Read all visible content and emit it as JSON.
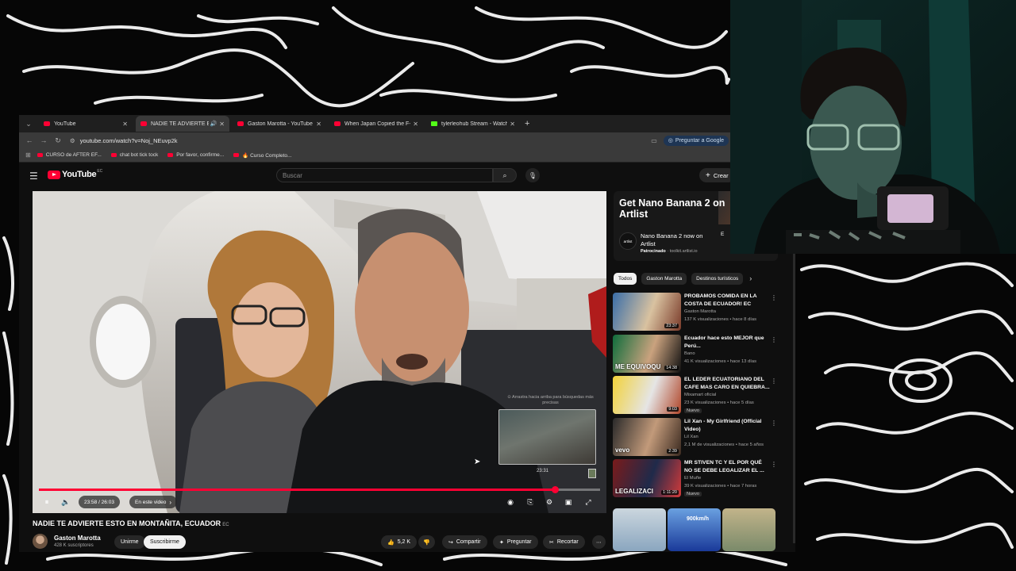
{
  "browser": {
    "tabs": [
      {
        "title": "YouTube",
        "active": false
      },
      {
        "title": "NADIE TE ADVIERTE ESTO E",
        "active": true
      },
      {
        "title": "Gaston Marotta - YouTube",
        "active": false
      },
      {
        "title": "When Japan Copied the F-16 -",
        "active": false
      },
      {
        "title": "tylerleohub Stream - Watch Li",
        "active": false
      }
    ],
    "url": "youtube.com/watch?v=Noj_NEuvp2k",
    "ask_google": "Preguntar a Google",
    "bookmarks": [
      "CURSO de AFTER EF...",
      "chat bot tick tock",
      "Por favor, confirme...",
      "🔥 Curso Completo..."
    ]
  },
  "youtube": {
    "logo": "YouTube",
    "logo_country": "EC",
    "search_placeholder": "Buscar",
    "create_label": "Crear"
  },
  "player": {
    "hover_hint": "⊙ Arrastra hacia arriba para búsquedas más precisas",
    "preview_time": "23:31",
    "time": "23:58 / 26:03",
    "chapter": "En este video",
    "progress": 0.92
  },
  "video": {
    "title": "NADIE TE ADVIERTE ESTO EN MONTAÑITA, ECUADOR",
    "title_flag": "EC",
    "channel": "Gaston Marotta",
    "subscribers": "428 K suscriptores",
    "join": "Unirme",
    "subscribe": "Suscribirme",
    "likes": "5,2 K",
    "share": "Compartir",
    "ask": "Preguntar",
    "clip": "Recortar"
  },
  "ad": {
    "headline": "Get Nano Banana 2 on Artlist",
    "logo": "artlist",
    "title": "Nano Banana 2 now on Artlist",
    "sponsored": "Patrocinado",
    "domain": "toolkit.artlist.io",
    "button": "E"
  },
  "chips": [
    "Todos",
    "Gaston Marotta",
    "Destinos turísticos"
  ],
  "recommendations": [
    {
      "title": "PROBAMOS COMIDA EN LA COSTA DE ECUADOR! EC",
      "channel": "Gaston Marotta",
      "meta": "137 K visualizaciones • hace 8 días",
      "duration": "23:37",
      "badge": "",
      "thumb": [
        "#3a6ea8",
        "#d9c2a0",
        "#7a3b2a"
      ],
      "overlay": ""
    },
    {
      "title": "Ecuador hace esto MEJOR que Perú...",
      "channel": "Bano",
      "meta": "41 K visualizaciones • hace 13 días",
      "duration": "14:38",
      "badge": "",
      "thumb": [
        "#0f6d3c",
        "#caa27e",
        "#111111"
      ],
      "overlay": "ME EQUIVOQU"
    },
    {
      "title": "EL LEDER ECUATORIANO DEL CAFE MAS CARO EN QUIEBRA...",
      "channel": "Mixamart oficial",
      "meta": "23 K visualizaciones • hace 5 días",
      "duration": "9:03",
      "badge": "Nuevo",
      "thumb": [
        "#f2d23a",
        "#e5e5e5",
        "#b0462a"
      ],
      "overlay": ""
    },
    {
      "title": "Lil Xan - My Girlfriend (Official Video)",
      "channel": "Lil Xan",
      "meta": "2,1 M de visualizaciones • hace 5 años",
      "duration": "2:39",
      "badge": "",
      "thumb": [
        "#2a2a2a",
        "#c29a7a",
        "#3b2a20"
      ],
      "overlay": "vevo"
    },
    {
      "title": "MR STIVEN TC Y EL POR QUÉ NO SE DEBE LEGALIZAR EL ...",
      "channel": "El Muñe",
      "meta": "39 K visualizaciones • hace 7 horas",
      "duration": "1:11:20",
      "badge": "Nuevo",
      "thumb": [
        "#7a1b1b",
        "#1f2a4a",
        "#d23a3a"
      ],
      "overlay": "LEGALIZACI"
    }
  ],
  "shorts": [
    {
      "label": "",
      "colors": [
        "#8aa6bf",
        "#cbd6de"
      ]
    },
    {
      "label": "900km/h",
      "colors": [
        "#1a3a9a",
        "#6aa0e0"
      ]
    },
    {
      "label": "",
      "colors": [
        "#7a8a6a",
        "#c2b48a"
      ]
    }
  ]
}
